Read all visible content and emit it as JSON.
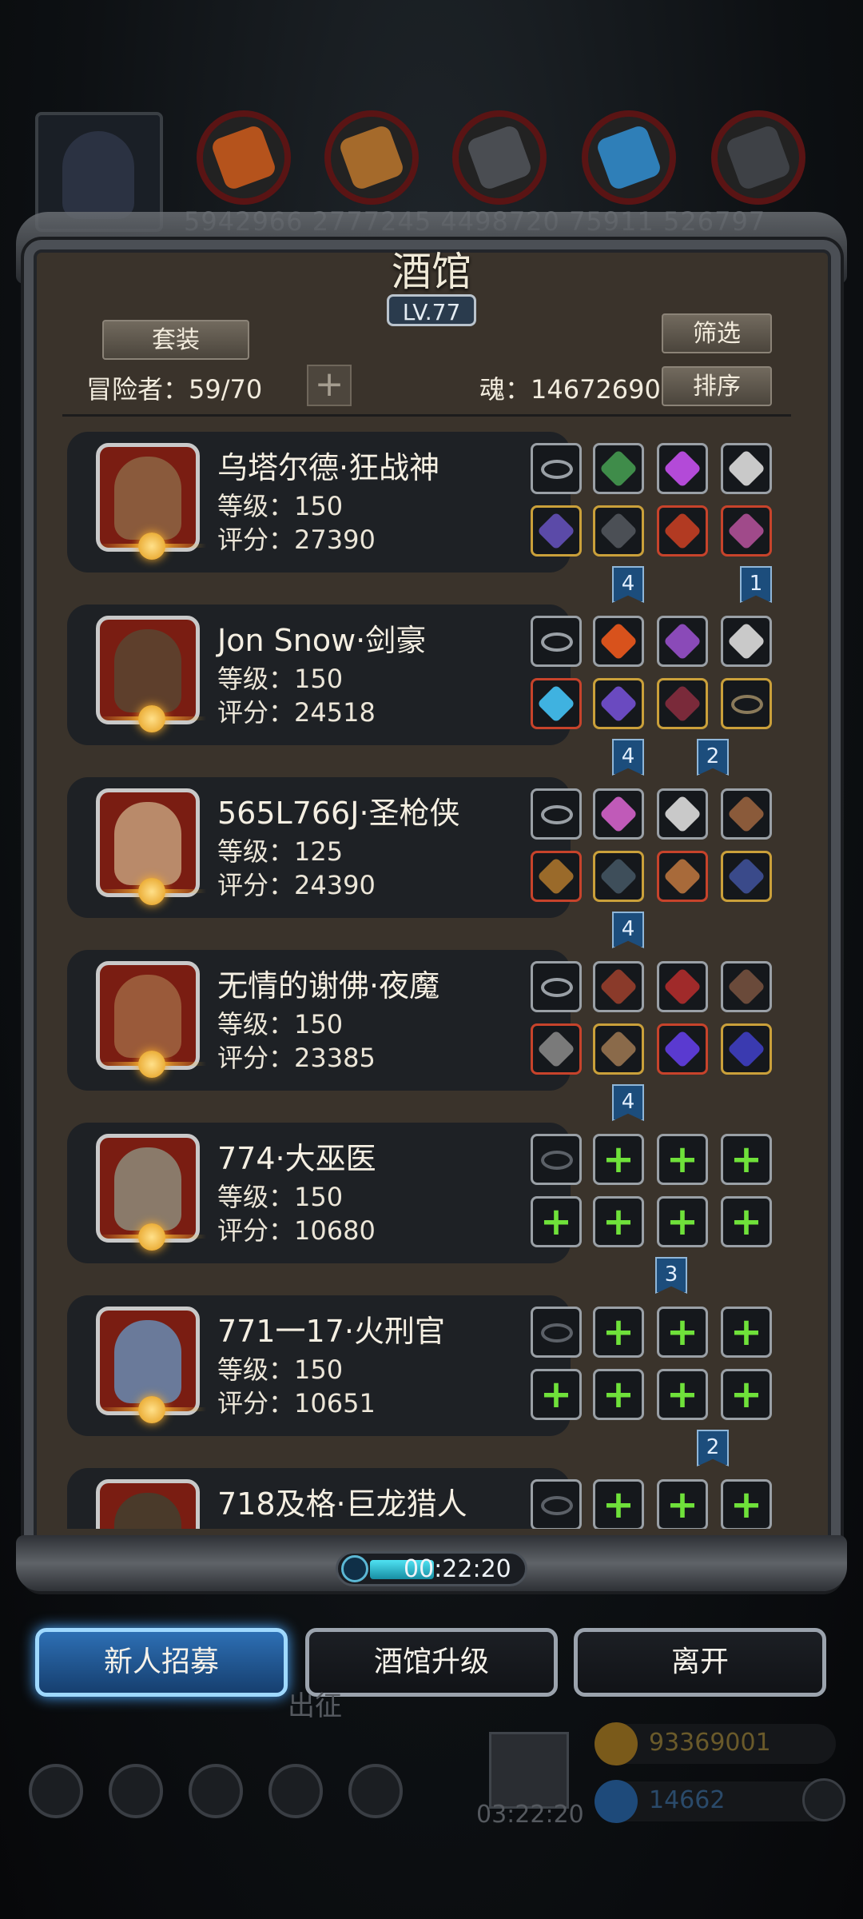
{
  "resources": {
    "values_text": "5942966  2777245  4498720  75911  526797"
  },
  "panel": {
    "title": "酒馆",
    "level": "LV.77",
    "suit_button": "套装",
    "filter_button": "筛选",
    "sort_button": "排序",
    "adventurers_label": "冒险者：59/70",
    "soul_label": "魂：14672690",
    "add_icon": "plus-icon"
  },
  "heroes": [
    {
      "name": "乌塔尔德·狂战神",
      "level": "等级：150",
      "score": "评分：27390",
      "tags": [
        "4",
        "1"
      ]
    },
    {
      "name": "Jon Snow·剑豪",
      "level": "等级：150",
      "score": "评分：24518",
      "tags": [
        "4",
        "2"
      ]
    },
    {
      "name": "565L766J·圣枪侠",
      "level": "等级：125",
      "score": "评分：24390",
      "tags": [
        "4"
      ]
    },
    {
      "name": "无情的谢佛·夜魔",
      "level": "等级：150",
      "score": "评分：23385",
      "tags": [
        "4"
      ]
    },
    {
      "name": "774·大巫医",
      "level": "等级：150",
      "score": "评分：10680",
      "tags": [
        "3"
      ]
    },
    {
      "name": "771一17·火刑官",
      "level": "等级：150",
      "score": "评分：10651",
      "tags": [
        "2"
      ]
    },
    {
      "name": "718及格·巨龙猎人",
      "level": "",
      "score": "",
      "tags": []
    }
  ],
  "timer": {
    "text": "00:22:20"
  },
  "actions": {
    "recruit": "新人招募",
    "upgrade": "酒馆升级",
    "leave": "离开"
  },
  "hud": {
    "march_label": "出征",
    "chest_timer": "03:22:20",
    "gold": "93369001",
    "gems": "14662"
  },
  "colors": {
    "accent": "#2d6fb4",
    "slot_plus": "#6fe13a",
    "tag_blue": "#1c4d7c"
  }
}
